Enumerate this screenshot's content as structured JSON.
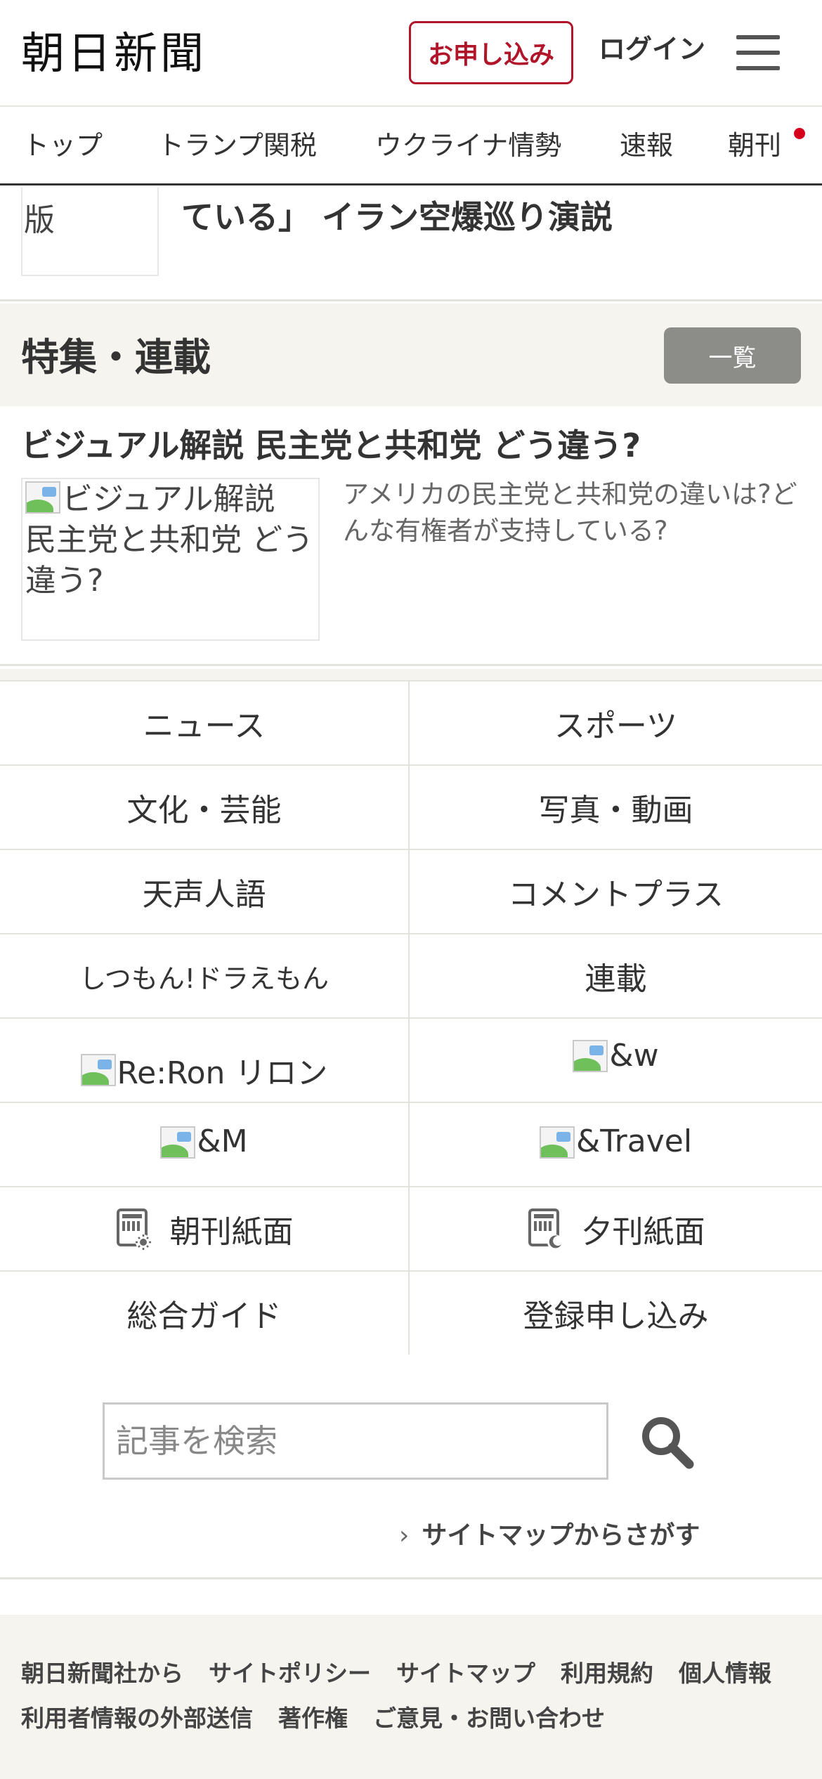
{
  "header": {
    "logo": "朝日新聞",
    "apply_label": "お申し込み",
    "login_label": "ログイン",
    "accent_color": "#b0152a"
  },
  "nav": {
    "items": [
      {
        "label": "トップ"
      },
      {
        "label": "トランプ関税"
      },
      {
        "label": "ウクライナ情勢"
      },
      {
        "label": "速報"
      },
      {
        "label": "朝刊"
      }
    ]
  },
  "prev_article": {
    "thumb_text": "版",
    "title": "ている」 イラン空爆巡り演説"
  },
  "feature": {
    "section_title": "特集・連載",
    "list_button": "一覧",
    "headline": "ビジュアル解説 民主党と共和党 どう違う?",
    "image_alt": "ビジュアル解説 民主党と共和党 どう違う?",
    "description": "アメリカの民主党と共和党の違いは?どんな有権者が支持している?"
  },
  "grid": {
    "items": [
      {
        "label": "ニュース"
      },
      {
        "label": "スポーツ"
      },
      {
        "label": "文化・芸能"
      },
      {
        "label": "写真・動画"
      },
      {
        "label": "天声人語"
      },
      {
        "label": "コメントプラス"
      },
      {
        "label": "しつもん!ドラえもん"
      },
      {
        "label": "連載"
      },
      {
        "label": "Re:Ron リロン"
      },
      {
        "label": "&w"
      },
      {
        "label": "&M"
      },
      {
        "label": "&Travel"
      },
      {
        "label": "朝刊紙面",
        "icon": "morning-paper-icon"
      },
      {
        "label": "夕刊紙面",
        "icon": "evening-paper-icon"
      },
      {
        "label": "総合ガイド"
      },
      {
        "label": "登録申し込み"
      }
    ]
  },
  "search": {
    "placeholder": "記事を検索",
    "icon": "search-icon",
    "sitemap_link": "サイトマップからさがす"
  },
  "footer": {
    "links": [
      "朝日新聞社から",
      "サイトポリシー",
      "サイトマップ",
      "利用規約",
      "個人情報",
      "利用者情報の外部送信",
      "著作権",
      "ご意見・お問い合わせ"
    ]
  }
}
